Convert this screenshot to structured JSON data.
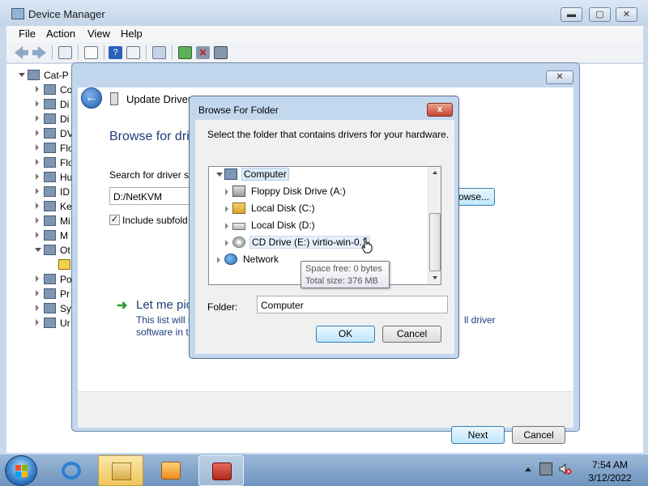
{
  "device_manager": {
    "title": "Device Manager",
    "menu": [
      "File",
      "Action",
      "View",
      "Help"
    ],
    "tree_root": "Cat-P",
    "tree_items": [
      {
        "label": "Co",
        "expanded": false
      },
      {
        "label": "Di",
        "expanded": false
      },
      {
        "label": "Di",
        "expanded": false
      },
      {
        "label": "DV",
        "expanded": false
      },
      {
        "label": "Flo",
        "expanded": false
      },
      {
        "label": "Flo",
        "expanded": false
      },
      {
        "label": "Hu",
        "expanded": false
      },
      {
        "label": "ID",
        "expanded": false
      },
      {
        "label": "Ke",
        "expanded": false
      },
      {
        "label": "Mi",
        "expanded": false
      },
      {
        "label": "M",
        "expanded": false
      },
      {
        "label": "Ot",
        "expanded": true
      },
      {
        "label": "",
        "expanded": false
      },
      {
        "label": "Po",
        "expanded": false
      },
      {
        "label": "Pr",
        "expanded": false
      },
      {
        "label": "Sy",
        "expanded": false
      },
      {
        "label": "Ur",
        "expanded": false
      }
    ]
  },
  "wizard": {
    "header": "Update Driver S",
    "heading": "Browse for dri",
    "search_label": "Search for driver so",
    "path_value": "D:/NetKVM",
    "browse_label": "rowse...",
    "include_label": "Include subfold",
    "let_me_pick": "Let me pic",
    "desc_line1": "This list will s",
    "desc_line2": "software in t",
    "desc_right": "ll driver",
    "next_label": "Next",
    "cancel_label": "Cancel"
  },
  "browse_dialog": {
    "title": "Browse For Folder",
    "close_label": "x",
    "instruction": "Select the folder that contains drivers for your hardware.",
    "tree": {
      "computer": "Computer",
      "floppy": "Floppy Disk Drive (A:)",
      "disk_c": "Local Disk (C:)",
      "disk_d": "Local Disk (D:)",
      "cd": "CD Drive (E:) virtio-win-0.1",
      "network": "Network"
    },
    "folder_label": "Folder:",
    "folder_value": "Computer",
    "ok_label": "OK",
    "cancel_label": "Cancel"
  },
  "tooltip": {
    "space_free": "Space free: 0 bytes",
    "total_size": "Total size: 376 MB"
  },
  "taskbar": {
    "time": "7:54 AM",
    "date": "3/12/2022"
  },
  "colors": {
    "accent_blue": "#1e3e7a",
    "close_red": "#c7452e",
    "selection": "#dceaf8"
  }
}
